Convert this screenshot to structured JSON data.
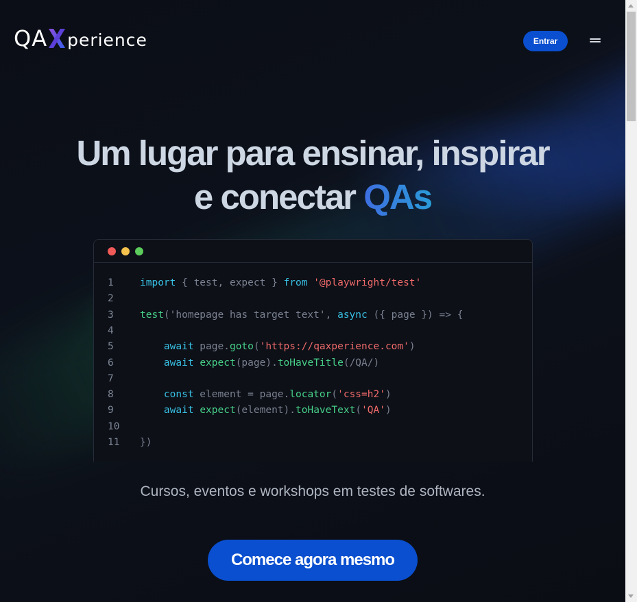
{
  "header": {
    "logo": {
      "part1": "QA",
      "part2": "perience"
    },
    "login_label": "Entrar"
  },
  "hero": {
    "title_line1": "Um lugar para ensinar, inspirar",
    "title_line2_prefix": "e conectar ",
    "title_accent": "QAs",
    "subtitle": "Cursos, eventos e workshops em testes de softwares.",
    "cta_label": "Comece agora mesmo"
  },
  "code": {
    "window_dots": [
      "#f05a58",
      "#f4c24d",
      "#5ccc5c"
    ],
    "lines": [
      {
        "n": "1",
        "tokens": [
          [
            "kw",
            "import"
          ],
          [
            "tx",
            " { test, expect } "
          ],
          [
            "kw",
            "from"
          ],
          [
            "tx",
            " "
          ],
          [
            "st",
            "'@playwright/test'"
          ]
        ]
      },
      {
        "n": "2",
        "tokens": []
      },
      {
        "n": "3",
        "tokens": [
          [
            "fn",
            "test"
          ],
          [
            "tx",
            "('homepage has target text', "
          ],
          [
            "kw",
            "async"
          ],
          [
            "tx",
            " ({ page }) => {"
          ]
        ]
      },
      {
        "n": "4",
        "tokens": []
      },
      {
        "n": "5",
        "tokens": [
          [
            "tx",
            "    "
          ],
          [
            "kw",
            "await"
          ],
          [
            "tx",
            " page."
          ],
          [
            "fn",
            "goto"
          ],
          [
            "tx",
            "("
          ],
          [
            "st",
            "'https://qaxperience.com'"
          ],
          [
            "tx",
            ")"
          ]
        ]
      },
      {
        "n": "6",
        "tokens": [
          [
            "tx",
            "    "
          ],
          [
            "kw",
            "await"
          ],
          [
            "tx",
            " "
          ],
          [
            "fn",
            "expect"
          ],
          [
            "tx",
            "(page)."
          ],
          [
            "fn",
            "toHaveTitle"
          ],
          [
            "tx",
            "(/QA/)"
          ]
        ]
      },
      {
        "n": "7",
        "tokens": []
      },
      {
        "n": "8",
        "tokens": [
          [
            "tx",
            "    "
          ],
          [
            "kw",
            "const"
          ],
          [
            "tx",
            " element = page."
          ],
          [
            "fn",
            "locator"
          ],
          [
            "tx",
            "("
          ],
          [
            "st",
            "'css=h2'"
          ],
          [
            "tx",
            ")"
          ]
        ]
      },
      {
        "n": "9",
        "tokens": [
          [
            "tx",
            "    "
          ],
          [
            "kw",
            "await"
          ],
          [
            "tx",
            " "
          ],
          [
            "fn",
            "expect"
          ],
          [
            "tx",
            "(element)."
          ],
          [
            "fn",
            "toHaveText"
          ],
          [
            "tx",
            "("
          ],
          [
            "st",
            "'QA'"
          ],
          [
            "tx",
            ")"
          ]
        ]
      },
      {
        "n": "10",
        "tokens": []
      },
      {
        "n": "11",
        "tokens": [
          [
            "tx",
            "})"
          ]
        ]
      }
    ]
  },
  "colors": {
    "accent": "#0a4fcf",
    "keyword": "#38c0e3",
    "function": "#47d18a",
    "string": "#ef6a6a",
    "code_text": "#7a8190"
  }
}
